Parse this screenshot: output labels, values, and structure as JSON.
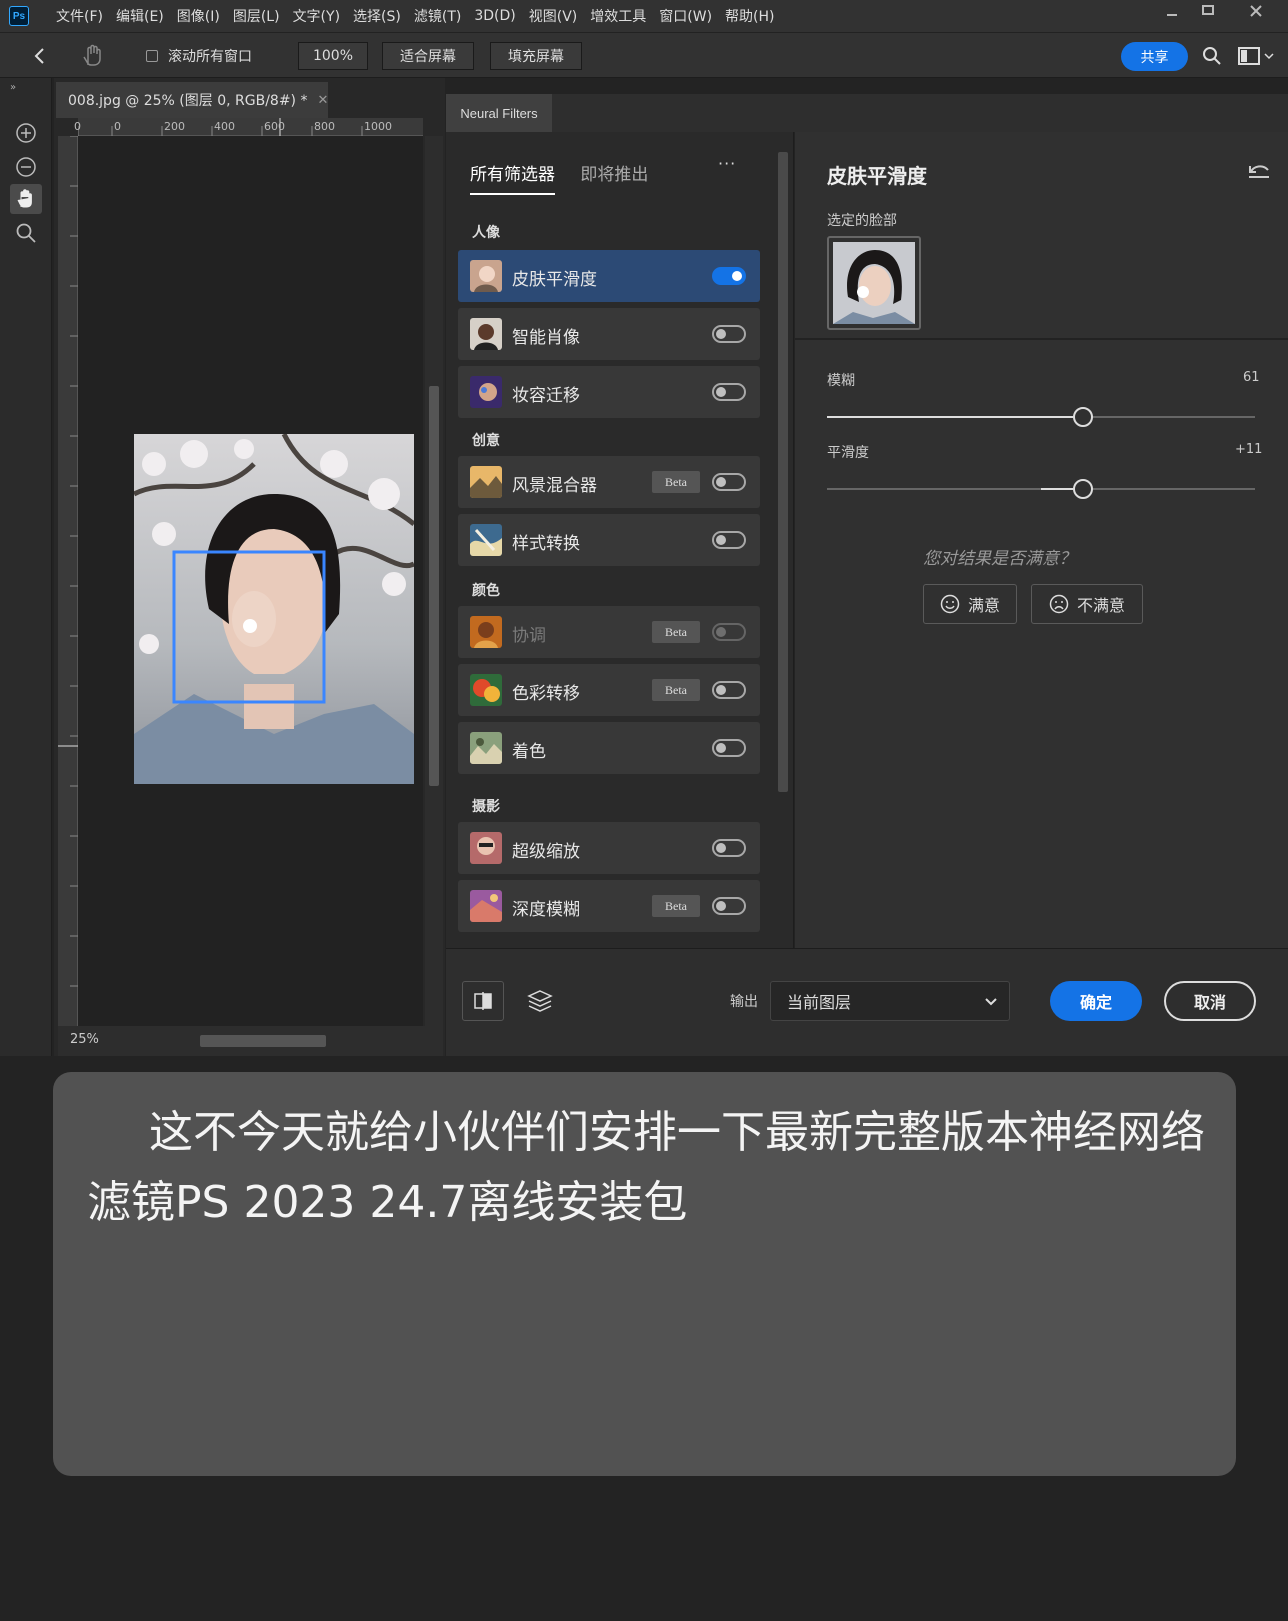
{
  "app": {
    "logo": "Ps"
  },
  "menu": [
    "文件(F)",
    "编辑(E)",
    "图像(I)",
    "图层(L)",
    "文字(Y)",
    "选择(S)",
    "滤镜(T)",
    "3D(D)",
    "视图(V)",
    "增效工具",
    "窗口(W)",
    "帮助(H)"
  ],
  "options": {
    "scroll_all_label": "滚动所有窗口",
    "zoom_value": "100%",
    "fit_screen": "适合屏幕",
    "fill_screen": "填充屏幕",
    "share": "共享"
  },
  "document": {
    "tab_title": "008.jpg @ 25% (图层 0, RGB/8#) *",
    "zoom": "25%",
    "ruler_ticks": [
      "0",
      "0",
      "200",
      "400",
      "600",
      "800",
      "1000"
    ]
  },
  "neural_filters": {
    "panel_title": "Neural Filters",
    "tabs": [
      "所有筛选器",
      "即将推出"
    ],
    "more": "···",
    "categories": {
      "portrait": "人像",
      "creative": "创意",
      "color": "颜色",
      "photo": "摄影"
    },
    "filters": [
      {
        "name": "皮肤平滑度",
        "beta": "",
        "on": true
      },
      {
        "name": "智能肖像",
        "beta": "",
        "on": false
      },
      {
        "name": "妆容迁移",
        "beta": "",
        "on": false
      },
      {
        "name": "风景混合器",
        "beta": "Beta",
        "on": false
      },
      {
        "name": "样式转换",
        "beta": "",
        "on": false
      },
      {
        "name": "协调",
        "beta": "Beta",
        "on": false
      },
      {
        "name": "色彩转移",
        "beta": "Beta",
        "on": false
      },
      {
        "name": "着色",
        "beta": "",
        "on": false
      },
      {
        "name": "超级缩放",
        "beta": "",
        "on": false
      },
      {
        "name": "深度模糊",
        "beta": "Beta",
        "on": false
      }
    ],
    "detail": {
      "title": "皮肤平滑度",
      "selected_face": "选定的脸部",
      "blur_label": "模糊",
      "blur_value": "61",
      "smooth_label": "平滑度",
      "smooth_value": "+11",
      "question": "您对结果是否满意？",
      "satisfied": "满意",
      "unsatisfied": "不满意"
    },
    "bottom": {
      "output_label": "输出",
      "output_value": "当前图层",
      "ok": "确定",
      "cancel": "取消"
    }
  },
  "caption": "这不今天就给小伙伴们安排一下最新完整版本神经网络滤镜PS 2023 24.7离线安装包"
}
